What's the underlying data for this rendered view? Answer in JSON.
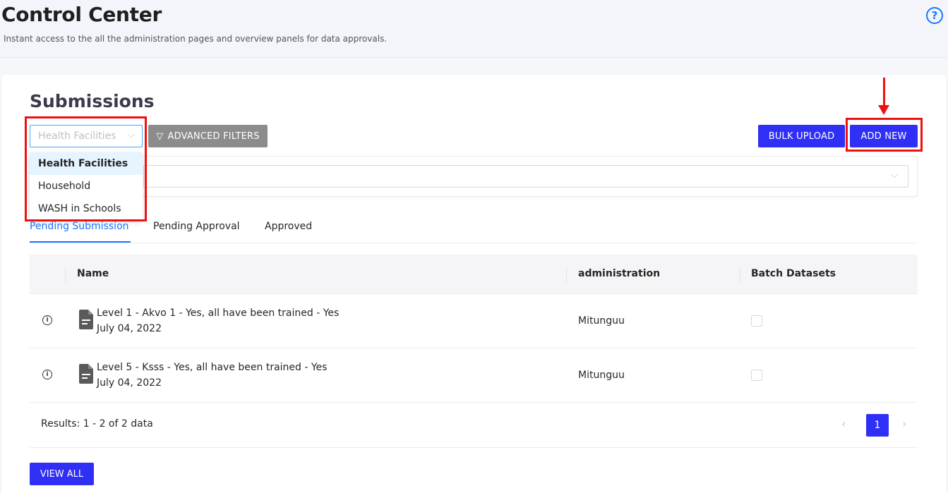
{
  "header": {
    "title": "Control Center",
    "subtitle": "Instant access to the all the administration pages and overview panels for data approvals.",
    "help_icon": "?"
  },
  "submissions": {
    "title": "Submissions",
    "form_select": {
      "value": "Health Facilities",
      "chevron": "⌵"
    },
    "advanced_filters_label": "ADVANCED FILTERS",
    "bulk_upload_label": "BULK UPLOAD",
    "add_new_label": "ADD NEW",
    "dropdown_options": [
      "Health Facilities",
      "Household",
      "WASH in Schools"
    ],
    "selected_option": "Health Facilities",
    "tabs": [
      {
        "label": "Pending Submission",
        "active": true
      },
      {
        "label": "Pending Approval",
        "active": false
      },
      {
        "label": "Approved",
        "active": false
      }
    ],
    "table": {
      "columns": [
        "Name",
        "administration",
        "Batch Datasets"
      ],
      "rows": [
        {
          "name": "Level 1 - Akvo 1 - Yes, all have been trained - Yes",
          "date": "July 04, 2022",
          "administration": "Mitunguu",
          "checked": false
        },
        {
          "name": "Level 5 - Ksss - Yes, all have been trained - Yes",
          "date": "July 04, 2022",
          "administration": "Mitunguu",
          "checked": false
        }
      ],
      "results_text": "Results: 1 - 2 of 2 data",
      "current_page": "1",
      "prev": "‹",
      "next": "›"
    },
    "view_all_label": "VIEW ALL"
  },
  "colors": {
    "primary": "#2f2ff5",
    "link_blue": "#1677ff",
    "annotation_red": "#ee1111",
    "disabled_gray": "#8c8c8c"
  }
}
